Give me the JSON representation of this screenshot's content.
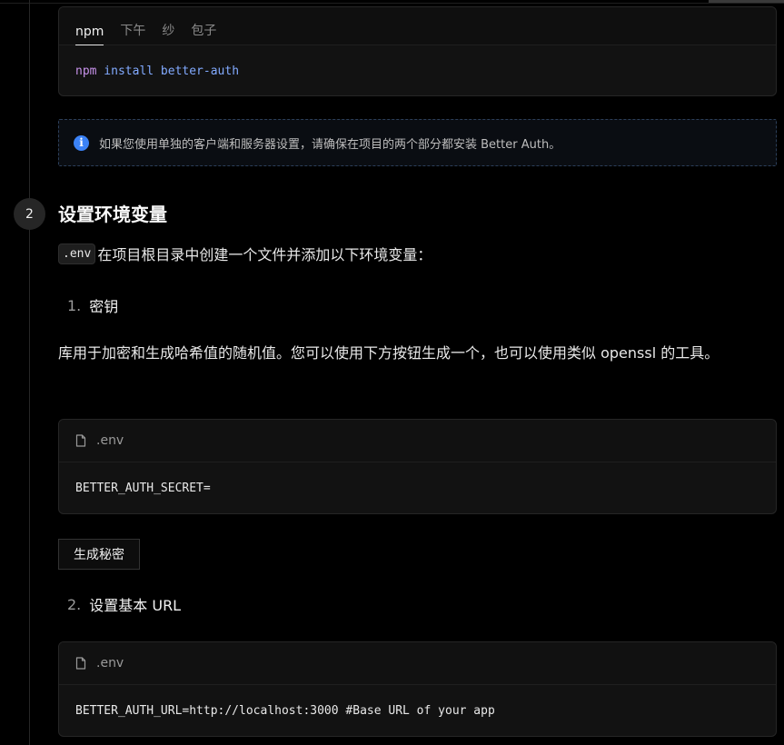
{
  "install": {
    "tabs": [
      {
        "label": "npm",
        "active": true
      },
      {
        "label": "下午",
        "active": false
      },
      {
        "label": "纱",
        "active": false
      },
      {
        "label": "包子",
        "active": false
      }
    ],
    "command": {
      "cmd": "npm",
      "rest": " install better-auth"
    }
  },
  "callout": {
    "icon": "info-icon",
    "text": "如果您使用单独的客户端和服务器设置，请确保在项目的两个部分都安装 Better Auth。"
  },
  "step": {
    "number": "2",
    "title": "设置环境变量"
  },
  "intro": {
    "code": ".env",
    "text": "在项目根目录中创建一个文件并添加以下环境变量："
  },
  "items": [
    {
      "number": "1.",
      "label": "密钥"
    },
    {
      "number": "2.",
      "label": "设置基本 URL"
    }
  ],
  "secret_description": "库用于加密和生成哈希值的随机值。您可以使用下方按钮生成一个，也可以使用类似 openssl 的工具。",
  "env_blocks": [
    {
      "filename": ".env",
      "code": "BETTER_AUTH_SECRET="
    },
    {
      "filename": ".env",
      "code": "BETTER_AUTH_URL=http://localhost:3000 #Base URL of your app"
    }
  ],
  "generate_button": "生成秘密",
  "colors": {
    "background": "#000000",
    "keyword": "#c792ea",
    "argument": "#82aaff",
    "info_accent": "#3b82f6"
  }
}
